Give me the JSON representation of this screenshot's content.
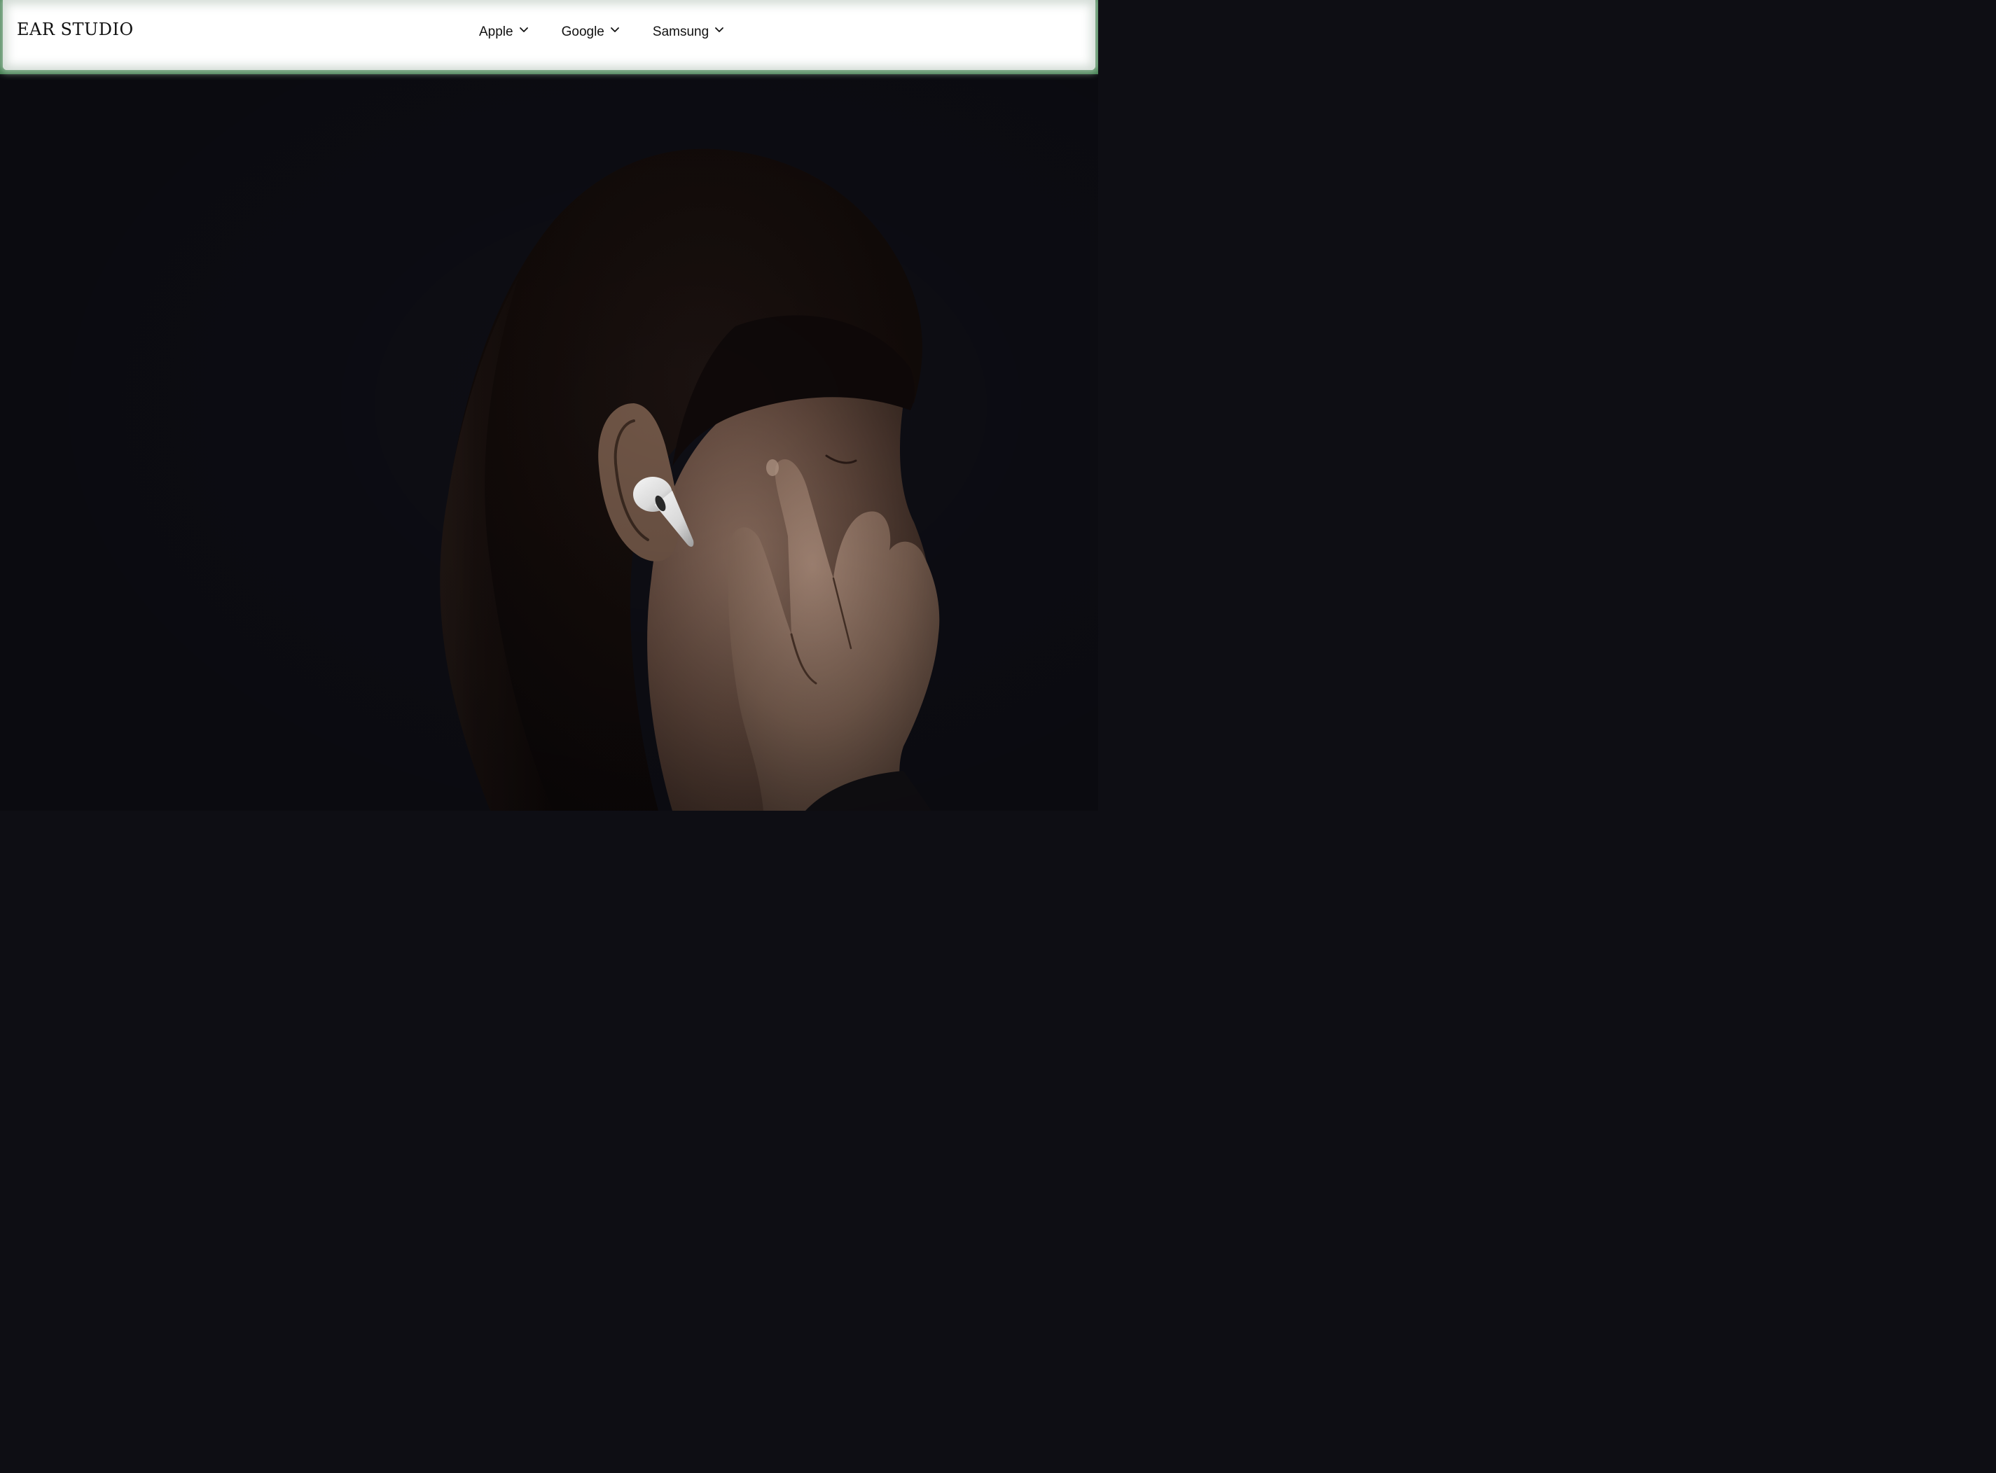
{
  "header": {
    "logo": "EAR STUDIO"
  },
  "nav": {
    "items": [
      {
        "label": "Apple",
        "icon": "chevron-down-icon"
      },
      {
        "label": "Google",
        "icon": "chevron-down-icon"
      },
      {
        "label": "Samsung",
        "icon": "chevron-down-icon"
      }
    ]
  },
  "hero": {
    "image": "woman-wearing-white-earbud-photo"
  },
  "colors": {
    "header_bg": "#ffffff",
    "header_edge": "#3e7a4c",
    "hero_bg": "#0e0e14",
    "text": "#111111"
  }
}
